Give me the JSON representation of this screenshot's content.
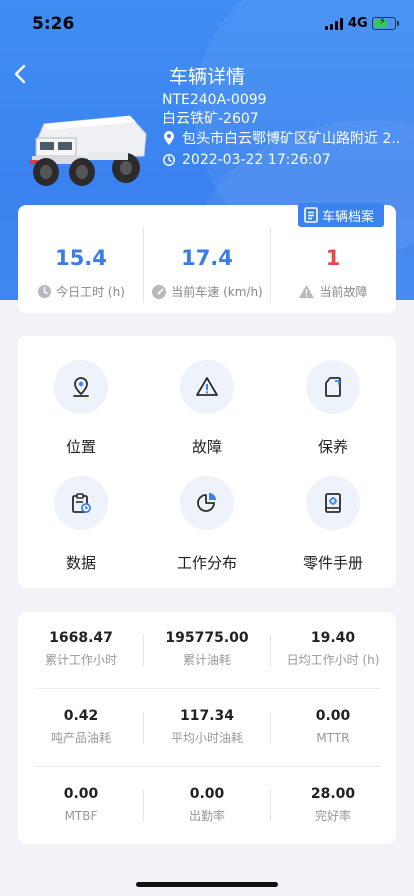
{
  "status_bar": {
    "time": "5:26",
    "network": "4G"
  },
  "header": {
    "title": "车辆详情",
    "vehicle_id": "NTE240A-0099",
    "vehicle_name": "白云铁矿-2607",
    "location": "包头市白云鄂博矿区矿山路附近 2...",
    "timestamp": "2022-03-22 17:26:07"
  },
  "stats": {
    "archive_label": "车辆档案",
    "items": [
      {
        "value": "15.4",
        "label": "今日工时 (h)",
        "icon": "clock-icon",
        "color": "#3b7de6"
      },
      {
        "value": "17.4",
        "label": "当前车速 (km/h)",
        "icon": "speedometer-icon",
        "color": "#3b7de6"
      },
      {
        "value": "1",
        "label": "当前故障",
        "icon": "warning-icon",
        "color": "#e5484d"
      }
    ]
  },
  "functions": [
    {
      "label": "位置",
      "icon": "location-pin-icon"
    },
    {
      "label": "故障",
      "icon": "fault-warning-icon"
    },
    {
      "label": "保养",
      "icon": "maintenance-icon"
    },
    {
      "label": "数据",
      "icon": "data-clipboard-icon"
    },
    {
      "label": "工作分布",
      "icon": "pie-chart-icon"
    },
    {
      "label": "零件手册",
      "icon": "parts-manual-icon"
    }
  ],
  "metrics": [
    {
      "value": "1668.47",
      "label": "累计工作小时"
    },
    {
      "value": "195775.00",
      "label": "累计油耗"
    },
    {
      "value": "19.40",
      "label": "日均工作小时 (h)"
    },
    {
      "value": "0.42",
      "label": "吨产品油耗"
    },
    {
      "value": "117.34",
      "label": "平均小时油耗"
    },
    {
      "value": "0.00",
      "label": "MTTR"
    },
    {
      "value": "0.00",
      "label": "MTBF"
    },
    {
      "value": "0.00",
      "label": "出勤率"
    },
    {
      "value": "28.00",
      "label": "完好率"
    }
  ]
}
